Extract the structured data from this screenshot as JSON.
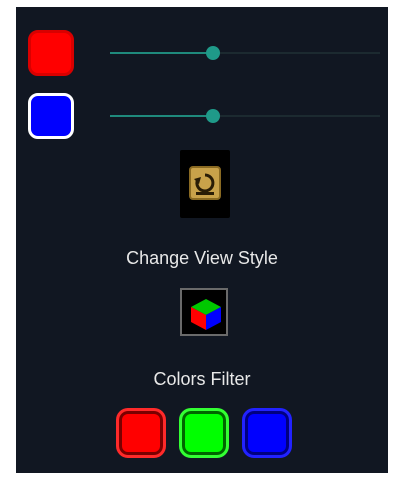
{
  "colors": {
    "panel_background": "#111722",
    "accent": "#1f9a89",
    "red": "#ff0000",
    "green": "#00ff00",
    "blue": "#0000ff"
  },
  "sliders": [
    {
      "name": "red-slider",
      "value": 0.38
    },
    {
      "name": "blue-slider",
      "value": 0.38
    }
  ],
  "view_style": {
    "label": "Change View Style",
    "icon": "rotate-icon"
  },
  "colors_filter": {
    "label": "Colors Filter",
    "icon": "rgb-cube-icon",
    "buttons": [
      {
        "name": "red",
        "color": "#ff0000"
      },
      {
        "name": "green",
        "color": "#00ff00"
      },
      {
        "name": "blue",
        "color": "#0000ff"
      }
    ]
  }
}
